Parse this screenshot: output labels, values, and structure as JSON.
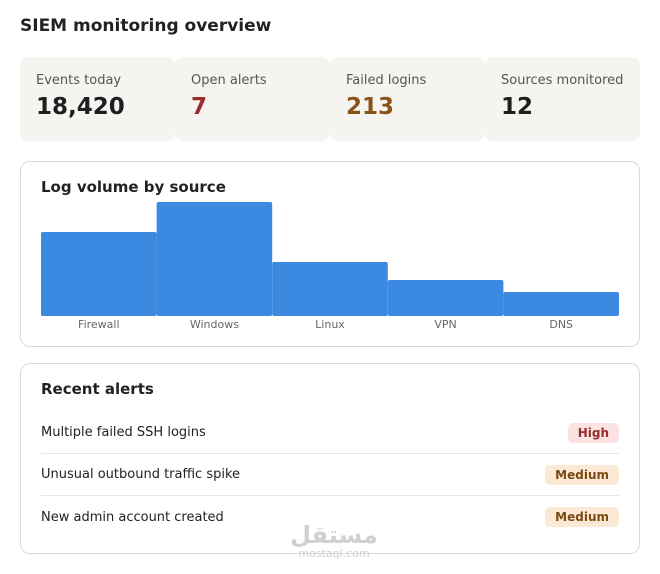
{
  "page": {
    "title": "SIEM monitoring overview"
  },
  "stats": [
    {
      "label": "Events today",
      "value": "18,420",
      "color": "#1f1f1f"
    },
    {
      "label": "Open alerts",
      "value": "7",
      "color": "#9b2c2c"
    },
    {
      "label": "Failed logins",
      "value": "213",
      "color": "#8a5418"
    },
    {
      "label": "Sources monitored",
      "value": "12",
      "color": "#1f1f1f"
    }
  ],
  "chart": {
    "title": "Log volume by source"
  },
  "chart_data": {
    "type": "bar",
    "title": "Log volume by source",
    "categories": [
      "Firewall",
      "Windows",
      "Linux",
      "VPN",
      "DNS"
    ],
    "values": [
      84,
      114,
      54,
      36,
      24
    ],
    "ylim": [
      0,
      114
    ],
    "xlabel": "",
    "ylabel": "",
    "grid": false,
    "bar_color": "#3b89e0"
  },
  "alerts": {
    "title": "Recent alerts",
    "items": [
      {
        "text": "Multiple failed SSH logins",
        "severity": "High",
        "level": "high"
      },
      {
        "text": "Unusual outbound traffic spike",
        "severity": "Medium",
        "level": "medium"
      },
      {
        "text": "New admin account created",
        "severity": "Medium",
        "level": "medium"
      }
    ]
  },
  "watermark": {
    "arabic": "مستقل",
    "latin": "mostaql.com"
  },
  "colors": {
    "accent": "#3b89e0",
    "high_badge_bg": "#fbe3e3",
    "high_badge_text": "#9b2c2c",
    "medium_badge_bg": "#fbe9d6",
    "medium_badge_text": "#7a4a12"
  }
}
